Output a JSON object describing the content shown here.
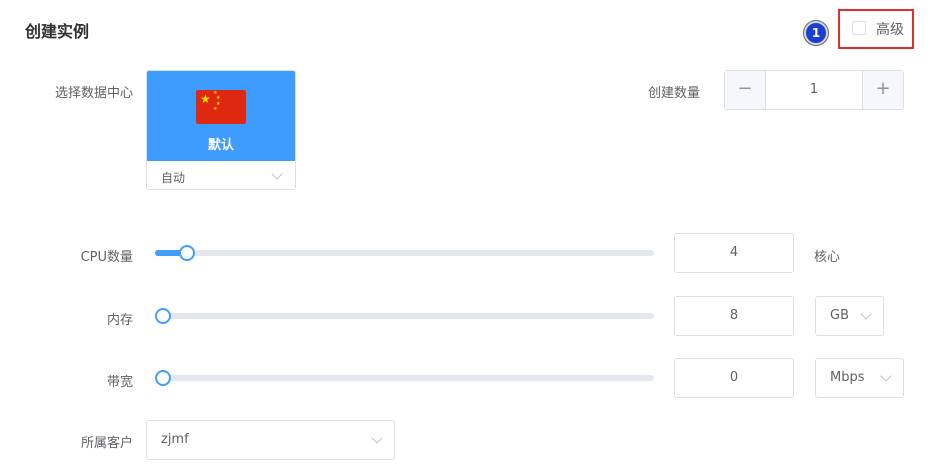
{
  "header": {
    "title": "创建实例",
    "badge": "1",
    "advanced_label": "高级"
  },
  "datacenter": {
    "label": "选择数据中心",
    "name": "默认",
    "select_value": "自动"
  },
  "quantity": {
    "label": "创建数量",
    "minus": "−",
    "value": "1",
    "plus": "+"
  },
  "cpu": {
    "label": "CPU数量",
    "value": "4",
    "unit": "核心",
    "level": 0.05
  },
  "memory": {
    "label": "内存",
    "value": "8",
    "unit": "GB",
    "level": 0
  },
  "bandwidth": {
    "label": "带宽",
    "value": "0",
    "unit": "Mbps",
    "level": 0
  },
  "customer": {
    "label": "所属客户",
    "value": "zjmf"
  },
  "colors": {
    "accent": "#409eff",
    "card": "#3f9cff",
    "highlight": "#e0302a",
    "badge": "#1b3fd6"
  }
}
